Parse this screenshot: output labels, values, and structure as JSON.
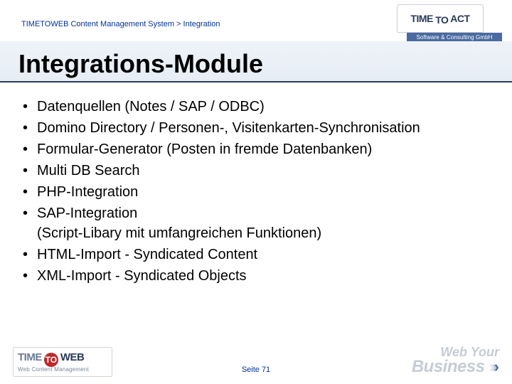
{
  "header": {
    "breadcrumb": "TIMETOWEB Content Management System > Integration",
    "title": "Integrations-Module",
    "brand_logo_main": "TIME TO ACT",
    "brand_logo_caption": "Software & Consulting GmbH"
  },
  "bullets": [
    "Datenquellen (Notes / SAP / ODBC)",
    "Domino Directory / Personen-, Visitenkarten-Synchronisation",
    "Formular-Generator (Posten in fremde Datenbanken)",
    "Multi DB Search",
    "PHP-Integration",
    "SAP-Integration\n(Script-Libary mit umfangreichen Funktionen)",
    "HTML-Import - Syndicated Content",
    "XML-Import - Syndicated Objects"
  ],
  "footer": {
    "page": "Seite 71",
    "ttw_time": "TIME",
    "ttw_to": "TO",
    "ttw_web": "WEB",
    "ttw_sub": "Web Content Management",
    "wyb_line1": "Web Your",
    "wyb_line2": "Business"
  }
}
